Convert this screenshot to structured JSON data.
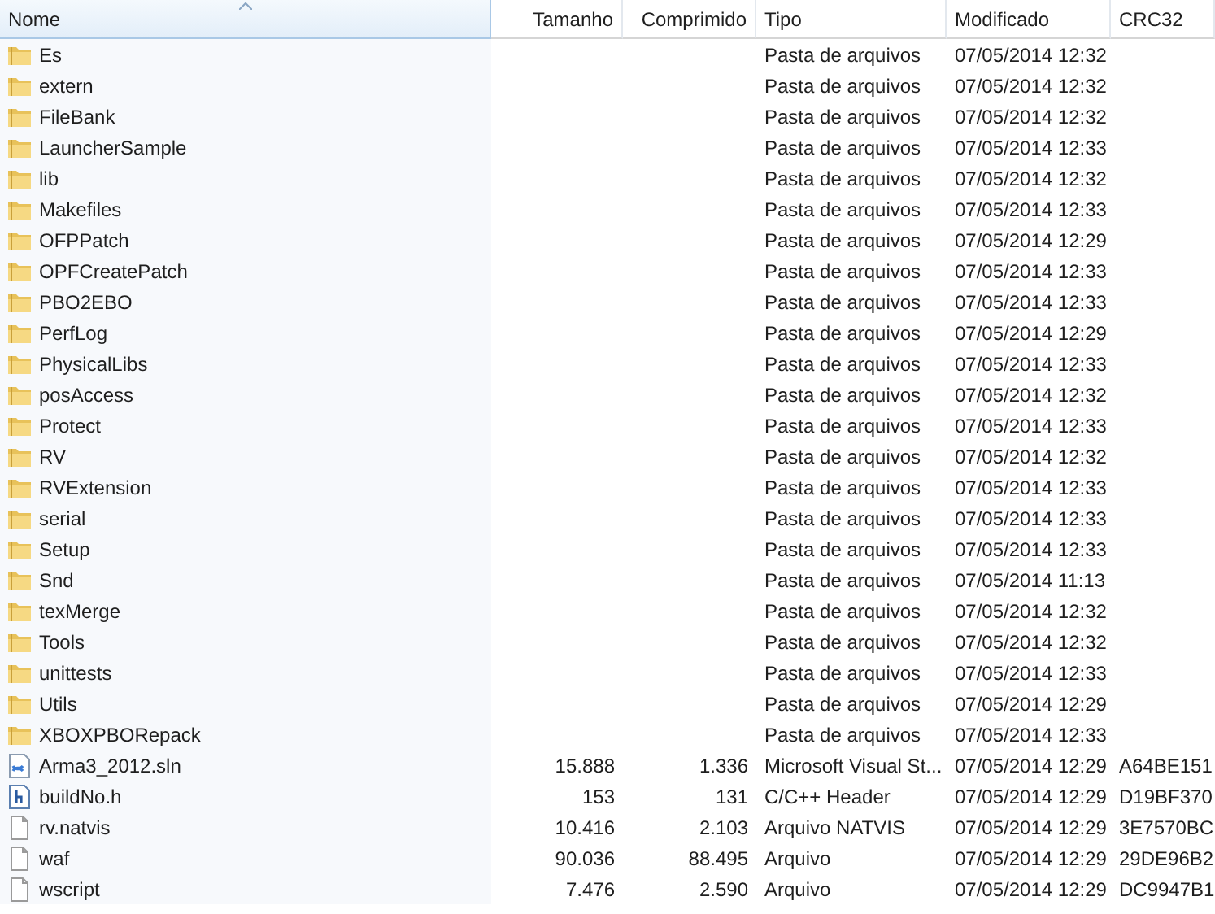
{
  "columns": [
    {
      "label": "Nome",
      "sorted": true
    },
    {
      "label": "Tamanho",
      "sorted": false
    },
    {
      "label": "Comprimido",
      "sorted": false
    },
    {
      "label": "Tipo",
      "sorted": false
    },
    {
      "label": "Modificado",
      "sorted": false
    },
    {
      "label": "CRC32",
      "sorted": false
    }
  ],
  "rows": [
    {
      "kind": "folder",
      "name": "Es",
      "type": "Pasta de arquivos",
      "modified": "07/05/2014 12:32"
    },
    {
      "kind": "folder",
      "name": "extern",
      "type": "Pasta de arquivos",
      "modified": "07/05/2014 12:32"
    },
    {
      "kind": "folder",
      "name": "FileBank",
      "type": "Pasta de arquivos",
      "modified": "07/05/2014 12:32"
    },
    {
      "kind": "folder",
      "name": "LauncherSample",
      "type": "Pasta de arquivos",
      "modified": "07/05/2014 12:33"
    },
    {
      "kind": "folder",
      "name": "lib",
      "type": "Pasta de arquivos",
      "modified": "07/05/2014 12:32"
    },
    {
      "kind": "folder",
      "name": "Makefiles",
      "type": "Pasta de arquivos",
      "modified": "07/05/2014 12:33"
    },
    {
      "kind": "folder",
      "name": "OFPPatch",
      "type": "Pasta de arquivos",
      "modified": "07/05/2014 12:29"
    },
    {
      "kind": "folder",
      "name": "OPFCreatePatch",
      "type": "Pasta de arquivos",
      "modified": "07/05/2014 12:33"
    },
    {
      "kind": "folder",
      "name": "PBO2EBO",
      "type": "Pasta de arquivos",
      "modified": "07/05/2014 12:33"
    },
    {
      "kind": "folder",
      "name": "PerfLog",
      "type": "Pasta de arquivos",
      "modified": "07/05/2014 12:29"
    },
    {
      "kind": "folder",
      "name": "PhysicalLibs",
      "type": "Pasta de arquivos",
      "modified": "07/05/2014 12:33"
    },
    {
      "kind": "folder",
      "name": "posAccess",
      "type": "Pasta de arquivos",
      "modified": "07/05/2014 12:32"
    },
    {
      "kind": "folder",
      "name": "Protect",
      "type": "Pasta de arquivos",
      "modified": "07/05/2014 12:33"
    },
    {
      "kind": "folder",
      "name": "RV",
      "type": "Pasta de arquivos",
      "modified": "07/05/2014 12:32"
    },
    {
      "kind": "folder",
      "name": "RVExtension",
      "type": "Pasta de arquivos",
      "modified": "07/05/2014 12:33"
    },
    {
      "kind": "folder",
      "name": "serial",
      "type": "Pasta de arquivos",
      "modified": "07/05/2014 12:33"
    },
    {
      "kind": "folder",
      "name": "Setup",
      "type": "Pasta de arquivos",
      "modified": "07/05/2014 12:33"
    },
    {
      "kind": "folder",
      "name": "Snd",
      "type": "Pasta de arquivos",
      "modified": "07/05/2014 11:13"
    },
    {
      "kind": "folder",
      "name": "texMerge",
      "type": "Pasta de arquivos",
      "modified": "07/05/2014 12:32"
    },
    {
      "kind": "folder",
      "name": "Tools",
      "type": "Pasta de arquivos",
      "modified": "07/05/2014 12:32"
    },
    {
      "kind": "folder",
      "name": "unittests",
      "type": "Pasta de arquivos",
      "modified": "07/05/2014 12:33"
    },
    {
      "kind": "folder",
      "name": "Utils",
      "type": "Pasta de arquivos",
      "modified": "07/05/2014 12:29"
    },
    {
      "kind": "folder",
      "name": "XBOXPBORepack",
      "type": "Pasta de arquivos",
      "modified": "07/05/2014 12:33"
    },
    {
      "kind": "solution",
      "name": "Arma3_2012.sln",
      "size": "15.888",
      "compressed": "1.336",
      "type": "Microsoft Visual St...",
      "modified": "07/05/2014 12:29",
      "crc": "A64BE151"
    },
    {
      "kind": "header",
      "name": "buildNo.h",
      "size": "153",
      "compressed": "131",
      "type": "C/C++ Header",
      "modified": "07/05/2014 12:29",
      "crc": "D19BF370"
    },
    {
      "kind": "file",
      "name": "rv.natvis",
      "size": "10.416",
      "compressed": "2.103",
      "type": "Arquivo NATVIS",
      "modified": "07/05/2014 12:29",
      "crc": "3E7570BC"
    },
    {
      "kind": "file",
      "name": "waf",
      "size": "90.036",
      "compressed": "88.495",
      "type": "Arquivo",
      "modified": "07/05/2014 12:29",
      "crc": "29DE96B2"
    },
    {
      "kind": "file",
      "name": "wscript",
      "size": "7.476",
      "compressed": "2.590",
      "type": "Arquivo",
      "modified": "07/05/2014 12:29",
      "crc": "DC9947B1"
    }
  ]
}
